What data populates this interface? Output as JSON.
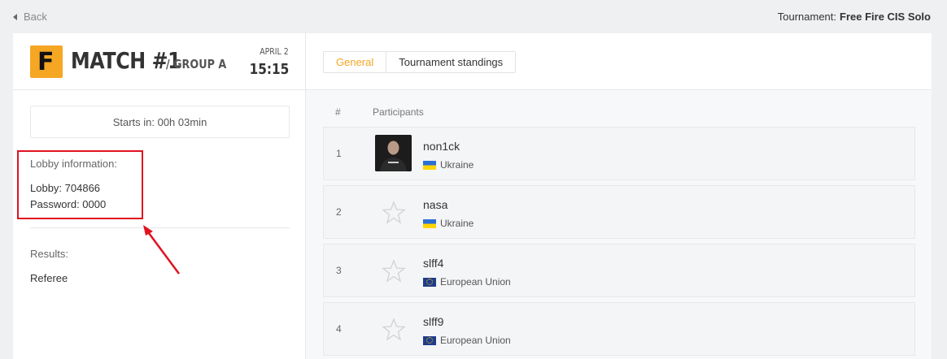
{
  "topbar": {
    "back_label": "Back",
    "tournament_label": "Tournament:",
    "tournament_name": "Free Fire CIS Solo"
  },
  "match": {
    "logo_letter": "F",
    "title": "MATCH #1",
    "group": "/ GROUP A",
    "date": "APRIL 2",
    "time": "15:15"
  },
  "left": {
    "starts_in": "Starts in: 00h 03min",
    "lobby_info_label": "Lobby information:",
    "lobby": "Lobby: 704866",
    "password": "Password: 0000",
    "results_label": "Results:",
    "referee_label": "Referee"
  },
  "tabs": [
    {
      "label": "General",
      "active": true
    },
    {
      "label": "Tournament standings",
      "active": false
    }
  ],
  "participants": {
    "col_num": "#",
    "col_participants": "Participants",
    "rows": [
      {
        "num": "1",
        "name": "non1ck",
        "country": "Ukraine",
        "flag": "ua-flag-icon",
        "avatar": "photo"
      },
      {
        "num": "2",
        "name": "nasa",
        "country": "Ukraine",
        "flag": "ua-flag-icon",
        "avatar": "star-icon"
      },
      {
        "num": "3",
        "name": "slff4",
        "country": "European Union",
        "flag": "eu-flag-icon",
        "avatar": "star-icon"
      },
      {
        "num": "4",
        "name": "slff9",
        "country": "European Union",
        "flag": "eu-flag-icon",
        "avatar": "star-icon"
      }
    ]
  },
  "colors": {
    "accent": "#f5a623",
    "annotation": "#e0121f"
  }
}
